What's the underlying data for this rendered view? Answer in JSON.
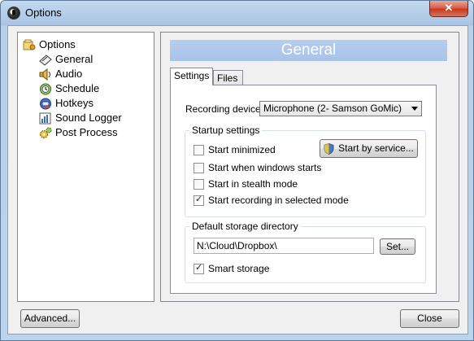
{
  "window": {
    "title": "Options",
    "close_glyph": "✕"
  },
  "tree": {
    "root": {
      "label": "Options",
      "icon": "options-icon"
    },
    "items": [
      {
        "label": "General",
        "icon": "general-icon"
      },
      {
        "label": "Audio",
        "icon": "speaker-icon"
      },
      {
        "label": "Schedule",
        "icon": "clock-icon"
      },
      {
        "label": "Hotkeys",
        "icon": "keyboard-icon"
      },
      {
        "label": "Sound Logger",
        "icon": "chart-icon"
      },
      {
        "label": "Post Process",
        "icon": "gears-icon"
      }
    ]
  },
  "panel": {
    "header": "General",
    "tabs": [
      {
        "label": "Settings",
        "active": true
      },
      {
        "label": "Files",
        "active": false
      }
    ]
  },
  "settings": {
    "recording_device_label": "Recording device",
    "recording_device_value": "Microphone (2- Samson GoMic)",
    "startup": {
      "legend": "Startup settings",
      "start_by_service": "Start by service...",
      "options": [
        {
          "label": "Start minimized",
          "checked": false
        },
        {
          "label": "Start when windows starts",
          "checked": false
        },
        {
          "label": "Start in stealth mode",
          "checked": false
        },
        {
          "label": "Start recording in selected mode",
          "checked": true
        }
      ]
    },
    "storage": {
      "legend": "Default storage directory",
      "path": "N:\\Cloud\\Dropbox\\",
      "set_button": "Set...",
      "smart_storage": {
        "label": "Smart storage",
        "checked": true
      }
    }
  },
  "footer": {
    "advanced": "Advanced...",
    "close": "Close"
  },
  "colors": {
    "header_bar": "#b5cdee",
    "window_frame": "#bcd3ec",
    "close_red": "#c6391f"
  }
}
